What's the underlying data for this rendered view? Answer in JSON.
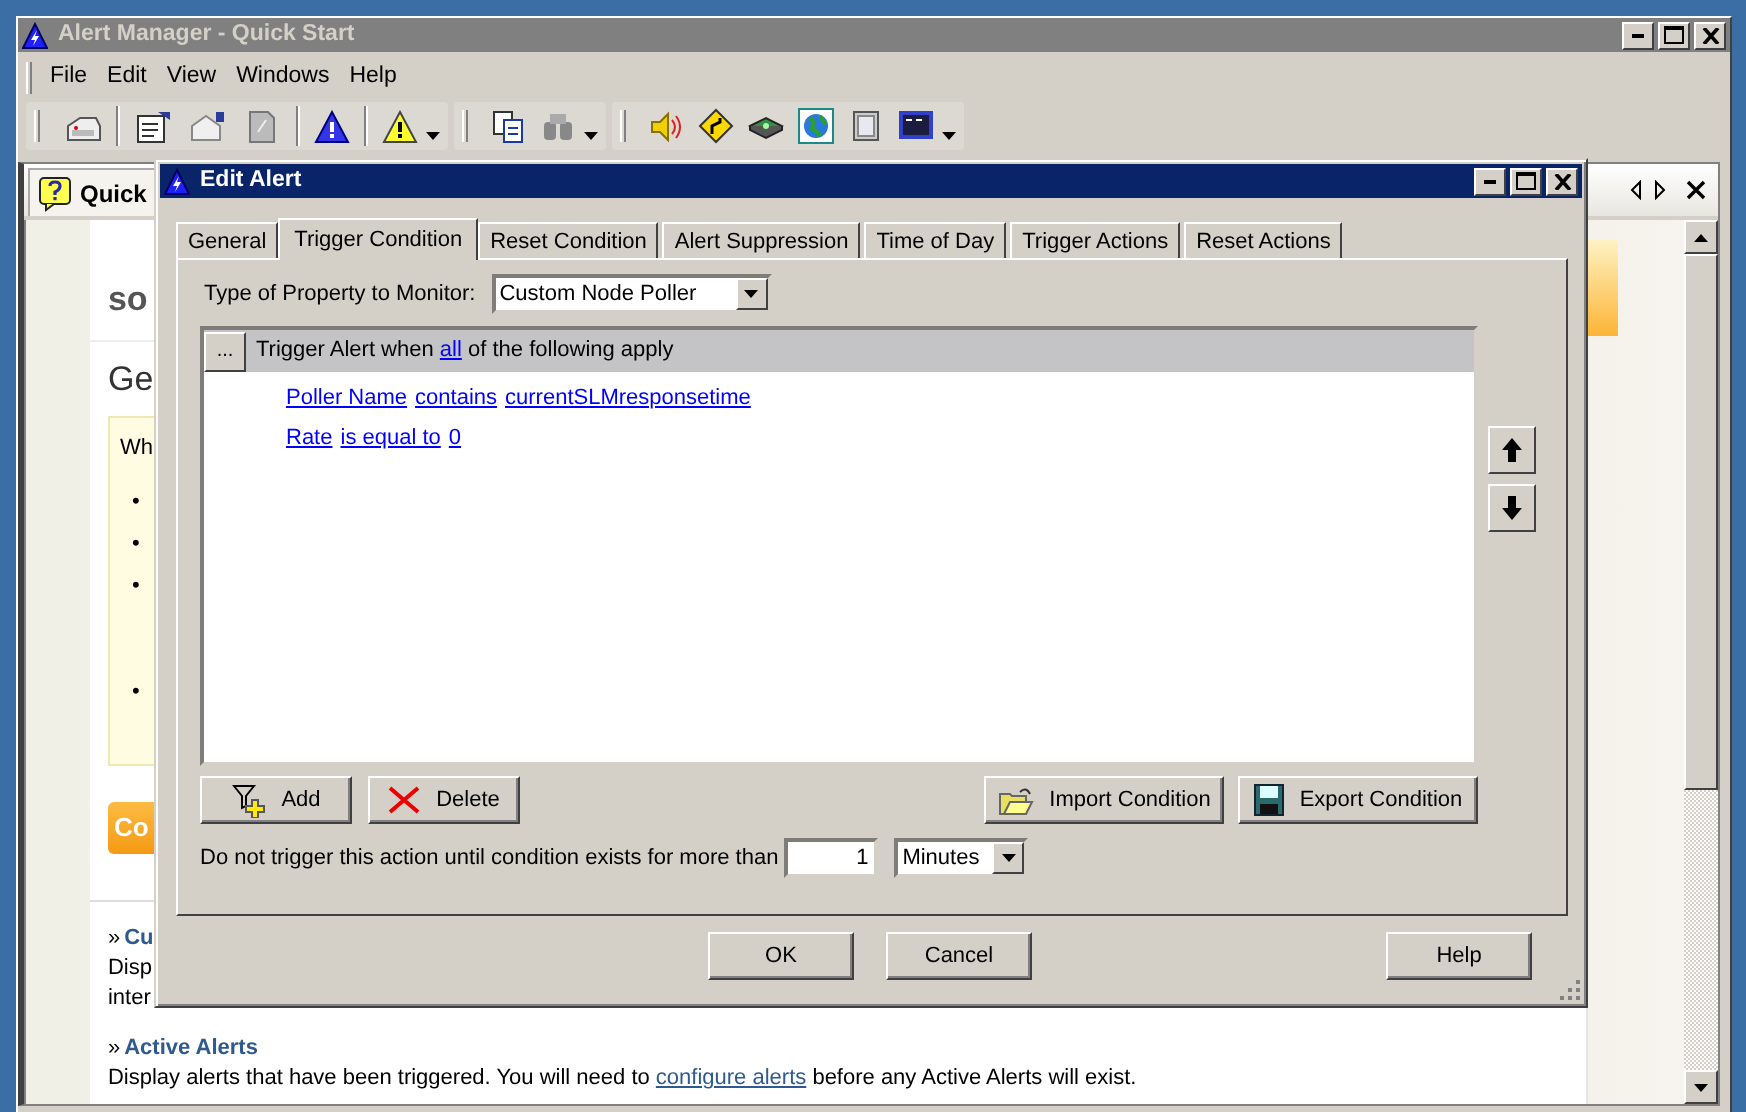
{
  "main_window": {
    "title": "Alert Manager - Quick Start",
    "active": false
  },
  "menu": [
    "File",
    "Edit",
    "View",
    "Windows",
    "Help"
  ],
  "doc_tab": {
    "label": "Quick",
    "selected": true
  },
  "page": {
    "heading": "so",
    "subheading": "Ge",
    "intro": "Wh",
    "bullets": [
      "•",
      "•",
      "•",
      "•"
    ],
    "action_button": "Co",
    "sections": [
      {
        "marker": "»",
        "title": "Cu",
        "lines": [
          "Disp",
          "inter"
        ]
      },
      {
        "marker": "»",
        "title": "Active Alerts",
        "text_before": "Display alerts that have been triggered. You will need to ",
        "link": "configure alerts",
        "text_after": " before any Active Alerts will exist."
      }
    ]
  },
  "dialog": {
    "title": "Edit Alert",
    "active": true,
    "tabs": [
      {
        "label": "General",
        "selected": false
      },
      {
        "label": "Trigger Condition",
        "selected": true
      },
      {
        "label": "Reset Condition",
        "selected": false
      },
      {
        "label": "Alert Suppression",
        "selected": false
      },
      {
        "label": "Time of Day",
        "selected": false
      },
      {
        "label": "Trigger Actions",
        "selected": false
      },
      {
        "label": "Reset Actions",
        "selected": false
      }
    ],
    "property_type": {
      "label": "Type of Property to Monitor:",
      "value": "Custom Node Poller"
    },
    "condition_header": {
      "button": "...",
      "text_before": "Trigger Alert when ",
      "link": "all",
      "text_after": " of the following apply"
    },
    "conditions": [
      {
        "field": "Poller Name",
        "operator": "contains",
        "value": "currentSLMresponsetime"
      },
      {
        "field": "Rate",
        "operator": "is equal to",
        "value": "0"
      }
    ],
    "condition_buttons": [
      {
        "kind": "add",
        "label": "Add"
      },
      {
        "kind": "delete",
        "label": "Delete"
      },
      {
        "kind": "import",
        "label": "Import Condition"
      },
      {
        "kind": "export",
        "label": "Export Condition"
      }
    ],
    "duration": {
      "label": "Do not trigger this action until condition exists for more than",
      "value": "1",
      "unit": "Minutes"
    },
    "footer_buttons": [
      "OK",
      "Cancel",
      "Help"
    ]
  }
}
